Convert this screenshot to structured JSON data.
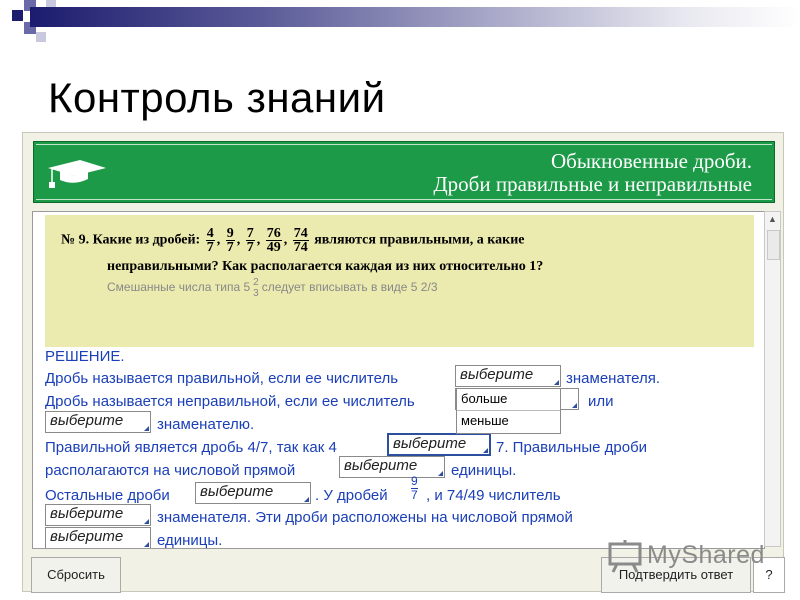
{
  "slide": {
    "title": "Контроль знаний"
  },
  "colors": {
    "banner": "#1c9a48",
    "question_bg": "#ecebaf",
    "solution_text": "#1a3fb8",
    "navy": "#1c1c6e"
  },
  "banner": {
    "line1": "Обыкновенные дроби.",
    "line2": "Дроби правильные и неправильные",
    "icon": "graduation-cap-icon"
  },
  "question": {
    "prefix": "№ 9. Какие из дробей:",
    "fractions": [
      {
        "num": "4",
        "den": "7"
      },
      {
        "num": "9",
        "den": "7"
      },
      {
        "num": "7",
        "den": "7"
      },
      {
        "num": "76",
        "den": "49"
      },
      {
        "num": "74",
        "den": "74"
      }
    ],
    "sep": ",",
    "suffix": "являются правильными, а какие",
    "line2": "неправильными? Как располагается каждая из них относительно 1?",
    "hint_prefix": "Смешанные числа типа 5",
    "hint_frac": {
      "num": "2",
      "den": "3"
    },
    "hint_suffix": "следует вписывать в виде  5 2/3"
  },
  "solution": {
    "heading": "РЕШЕНИЕ.",
    "line1": "Дробь называется правильной, если ее числитель",
    "line1_end": "знаменателя.",
    "line2": "Дробь называется неправильной, если ее числитель",
    "line2_end": "или",
    "line3_end": "знаменателю.",
    "line4_a": "Правильной является дробь 4/7, так как 4",
    "line4_b": "7. Правильные дроби",
    "line5": "располагаются на числовой прямой",
    "line5_end": "единицы.",
    "line6_a": "Остальные дроби",
    "line6_b": ". У дробей",
    "line6_frac": {
      "num": "9",
      "den": "7"
    },
    "line6_c": ", и 74/49 числитель",
    "line7": "знаменателя. Эти дроби расположены на числовой прямой",
    "line8": "единицы.",
    "dropdown_placeholder": "выберите",
    "dropdown_options": [
      "больше",
      "меньше"
    ]
  },
  "footer": {
    "reset": "Сбросить",
    "confirm": "Подтвердить ответ",
    "help": "?"
  },
  "watermark": {
    "text": "MyShared",
    "icon": "presentation-board-icon"
  }
}
